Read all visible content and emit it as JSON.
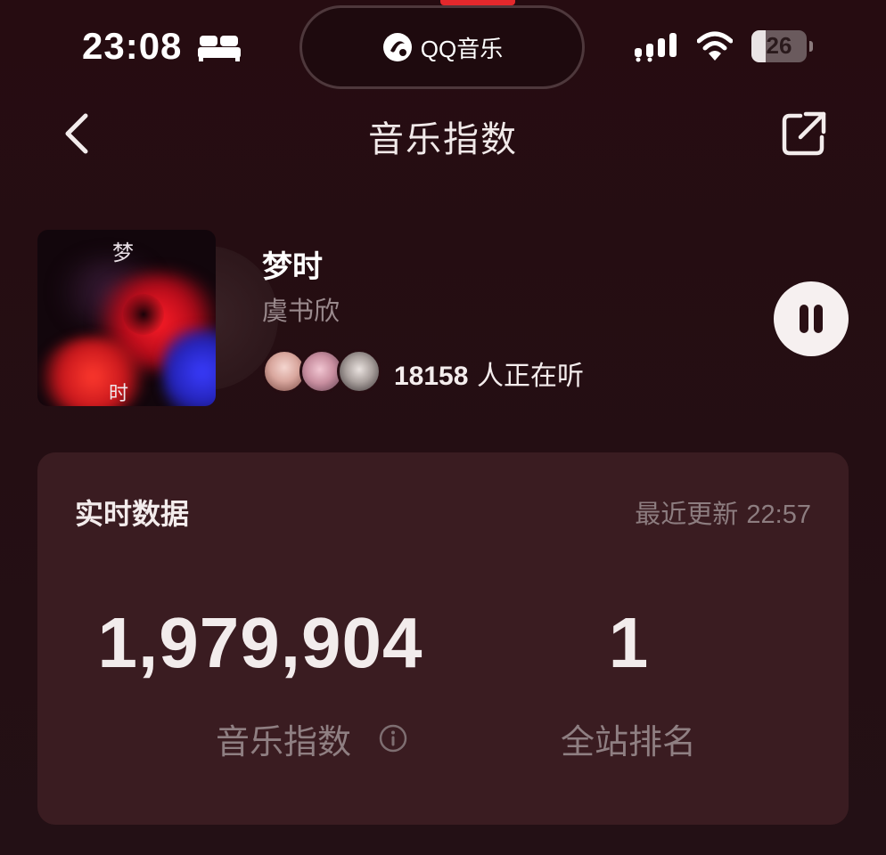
{
  "status_bar": {
    "time": "23:08",
    "app_label": "QQ音乐",
    "battery_level": "26",
    "battery_fraction": 0.26,
    "icons": [
      "bed-icon",
      "qq-music-logo-icon",
      "signal-icon",
      "wifi-icon",
      "battery-icon"
    ]
  },
  "nav": {
    "title": "音乐指数",
    "back_icon": "chevron-left-icon",
    "share_icon": "share-external-icon"
  },
  "song": {
    "cover_text_top": "梦",
    "cover_text_bottom": "时",
    "title": "梦时",
    "artist": "虞书欣",
    "listeners_count": "18158",
    "listeners_suffix": " 人正在听",
    "play_state_icon": "pause-icon"
  },
  "realtime": {
    "title": "实时数据",
    "updated_label": "最近更新 ",
    "updated_time": "22:57",
    "index_value": "1,979,904",
    "index_label": "音乐指数",
    "rank_value": "1",
    "rank_label": "全站排名",
    "info_icon": "info-icon"
  },
  "colors": {
    "background": "#240d11",
    "card": "#3a1c21",
    "accent": "#e3282c",
    "muted_text": "#8f7f82"
  }
}
